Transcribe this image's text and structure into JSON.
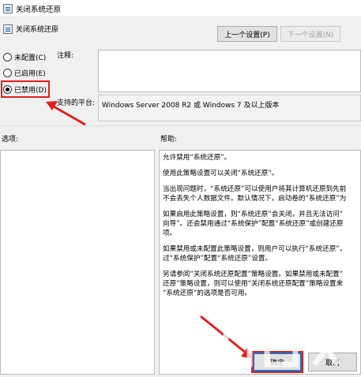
{
  "window": {
    "title": "关闭系统还原"
  },
  "header": {
    "setting_name": "关闭系统还原",
    "prev_button": "上一个设置(P)",
    "next_button": "下一个设置(N)"
  },
  "state": {
    "options": [
      {
        "label": "未配置(C)",
        "checked": false
      },
      {
        "label": "已启用(E)",
        "checked": false
      },
      {
        "label": "已禁用(D)",
        "checked": true
      }
    ]
  },
  "comment": {
    "label": "注释:",
    "value": ""
  },
  "platform": {
    "label": "支持的平台:",
    "value": "Windows Server 2008 R2 或 Windows 7 及以上版本"
  },
  "options_section": {
    "label": "选项:"
  },
  "help_section": {
    "label": "帮助:",
    "paragraphs": [
      "允许禁用“系统还原”。",
      "使用此策略设置可以关闭“系统还原”。",
      "当出现问题时，“系统还原”可以使用户将其计算机还原到先前\n不会丢失个人数据文件。默认情况下，启动卷的“系统还原”为",
      "如果启用此策略设置，则“系统还原”会关闭，并且无法访问“\n向导”。还会禁用通过“系统保护”配置“系统还原”或创建还原\n项。",
      "如果禁用或未配置此策略设置，则用户可以执行“系统还原”，\n过“系统保护”配置“系统还原”设置。",
      "另请参阅“关闭系统还原配置”策略设置。如果禁用或未配置“\n还原”策略设置，则可以使用“关闭系统还原配置”策略设置来\n“系统还原”的选项是否可用。"
    ]
  },
  "footer": {
    "ok_button": "确定",
    "cancel_button": "取消"
  },
  "colors": {
    "annotation": "#e02020",
    "focus": "#0078d7"
  }
}
